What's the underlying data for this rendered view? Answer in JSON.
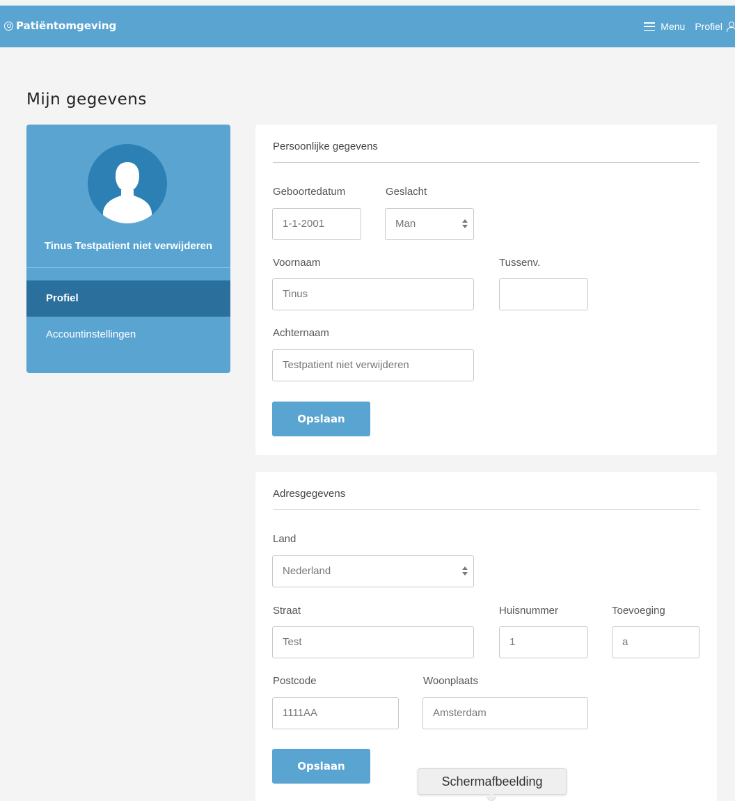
{
  "header": {
    "brand": "Patiëntomgeving",
    "menu_label": "Menu",
    "profile_label": "Profiel",
    "bg_color": "#5aa4d2"
  },
  "page": {
    "title": "Mijn gegevens"
  },
  "sidebar": {
    "user_name": "Tinus Testpatient niet verwijderen",
    "items": [
      {
        "label": "Profiel",
        "active": true
      },
      {
        "label": "Accountinstellingen",
        "active": false
      }
    ],
    "active_color": "#2b6f9c"
  },
  "personal": {
    "title": "Persoonlijke gegevens",
    "birthdate": {
      "label": "Geboortedatum",
      "value": "1-1-2001"
    },
    "gender": {
      "label": "Geslacht",
      "value": "Man"
    },
    "firstname": {
      "label": "Voornaam",
      "value": "Tinus"
    },
    "infix": {
      "label": "Tussenv.",
      "value": ""
    },
    "lastname": {
      "label": "Achternaam",
      "value": "Testpatient niet verwijderen"
    },
    "save_label": "Opslaan"
  },
  "address": {
    "title": "Adresgegevens",
    "country": {
      "label": "Land",
      "value": "Nederland"
    },
    "street": {
      "label": "Straat",
      "value": "Test"
    },
    "housenumber": {
      "label": "Huisnummer",
      "value": "1"
    },
    "addition": {
      "label": "Toevoeging",
      "value": "a"
    },
    "postcode": {
      "label": "Postcode",
      "value": "1111AA"
    },
    "city": {
      "label": "Woonplaats",
      "value": "Amsterdam"
    },
    "save_label": "Opslaan"
  },
  "tooltip": {
    "text": "Schermafbeelding"
  }
}
